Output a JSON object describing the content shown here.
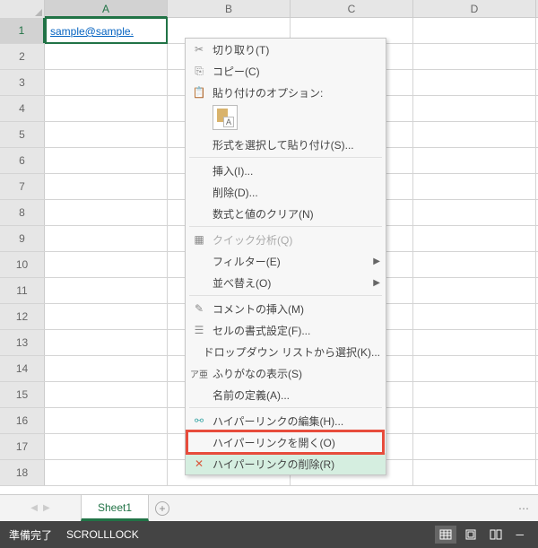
{
  "columns": [
    "A",
    "B",
    "C",
    "D"
  ],
  "rows": [
    1,
    2,
    3,
    4,
    5,
    6,
    7,
    8,
    9,
    10,
    11,
    12,
    13,
    14,
    15,
    16,
    17,
    18
  ],
  "active_cell": {
    "row": 1,
    "col": "A",
    "value": "sample@sample."
  },
  "context_menu": {
    "cut": "切り取り(T)",
    "copy": "コピー(C)",
    "paste_options_header": "貼り付けのオプション:",
    "paste_special": "形式を選択して貼り付け(S)...",
    "insert": "挿入(I)...",
    "delete": "削除(D)...",
    "clear": "数式と値のクリア(N)",
    "quick_analysis": "クイック分析(Q)",
    "filter": "フィルター(E)",
    "sort": "並べ替え(O)",
    "insert_comment": "コメントの挿入(M)",
    "format_cells": "セルの書式設定(F)...",
    "dropdown": "ドロップダウン リストから選択(K)...",
    "furigana": "ふりがなの表示(S)",
    "define_name": "名前の定義(A)...",
    "edit_hyperlink": "ハイパーリンクの編集(H)...",
    "open_hyperlink": "ハイパーリンクを開く(O)",
    "remove_hyperlink": "ハイパーリンクの削除(R)"
  },
  "tabs": {
    "sheet1": "Sheet1"
  },
  "status": {
    "ready": "準備完了",
    "scrolllock": "SCROLLLOCK"
  }
}
